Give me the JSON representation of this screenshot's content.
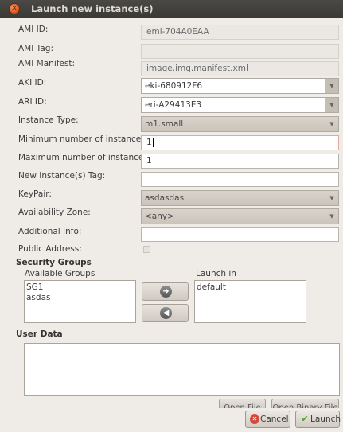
{
  "window": {
    "title": "Launch new instance(s)",
    "close_icon": "x"
  },
  "form": {
    "ami_id": {
      "label": "AMI ID:",
      "value": "emi-704A0EAA"
    },
    "ami_tag": {
      "label": "AMI Tag:",
      "value": ""
    },
    "ami_manifest": {
      "label": "AMI Manifest:",
      "value": "image.img.manifest.xml"
    },
    "aki_id": {
      "label": "AKI ID:",
      "value": "eki-680912F6"
    },
    "ari_id": {
      "label": "ARI ID:",
      "value": "eri-A29413E3"
    },
    "instance_type": {
      "label": "Instance Type:",
      "value": "m1.small"
    },
    "min_instances": {
      "label": "Minimum number of instances:",
      "value": "1"
    },
    "max_instances": {
      "label": "Maximum number of instances:",
      "value": "1"
    },
    "instance_tag": {
      "label": "New Instance(s) Tag:",
      "value": ""
    },
    "keypair": {
      "label": "KeyPair:",
      "value": "asdasdas"
    },
    "availability_zone": {
      "label": "Availability Zone:",
      "value": "<any>"
    },
    "additional_info": {
      "label": "Additional Info:",
      "value": ""
    },
    "public_address": {
      "label": "Public Address:",
      "checked": false
    }
  },
  "security_groups": {
    "heading": "Security Groups",
    "available_label": "Available Groups",
    "available": [
      "SG1",
      "asdas"
    ],
    "launch_in_label": "Launch in",
    "launch_in": [
      "default"
    ]
  },
  "user_data": {
    "heading": "User Data",
    "value": ""
  },
  "buttons": {
    "open_file": "Open File",
    "open_binary_file": "Open Binary File",
    "cancel": "Cancel",
    "launch": "Launch"
  },
  "icons": {
    "move_right": "arrow-right-icon",
    "move_left": "arrow-left-icon",
    "dropdown": "chevron-down-icon"
  },
  "colors": {
    "titlebar": "#3b3a36",
    "close_button": "#e05a1e",
    "background": "#efebe7"
  }
}
